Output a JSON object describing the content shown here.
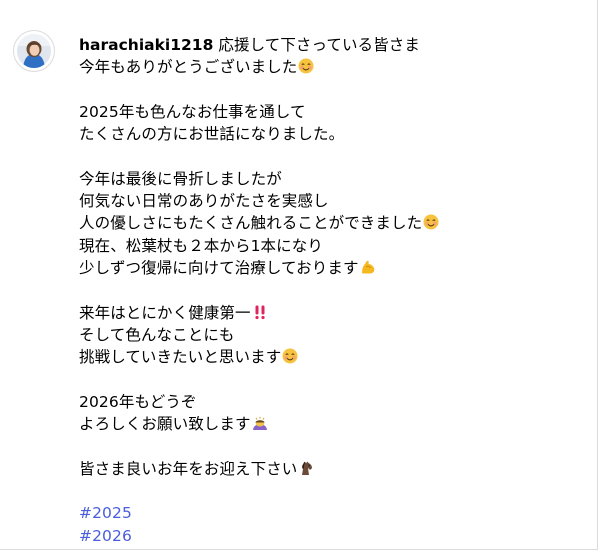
{
  "post": {
    "username": "harachiaki1218",
    "lines": [
      "応援して下さっている皆さま",
      "今年もありがとうございました",
      "",
      "2025年も色んなお仕事を通して",
      "たくさんの方にお世話になりました。",
      "",
      "今年は最後に骨折しましたが",
      "何気ない日常のありがたさを実感し",
      "人の優しさにもたくさん触れることができました",
      "現在、松葉杖も２本から1本になり",
      "少しずつ復帰に向けて治療しております",
      "",
      "来年はとにかく健康第一",
      "そして色んなことにも",
      "挑戦していきたいと思います",
      "",
      "2026年もどうぞ",
      "よろしくお願い致します",
      "",
      "皆さま良いお年をお迎え下さい"
    ],
    "hashtags": [
      "#2025",
      "#2026"
    ]
  },
  "emojis": {
    "line1": "smiling-face-icon",
    "line8": "smiling-face-icon",
    "line10": "flexed-biceps-icon",
    "line12": "double-exclamation-icon",
    "line14": "smiling-face-icon",
    "line17": "bowing-person-icon",
    "line19": "horse-icon"
  },
  "colors": {
    "hashtag": "#4a5ddb",
    "border": "#dbdbdb",
    "text": "#000000"
  }
}
